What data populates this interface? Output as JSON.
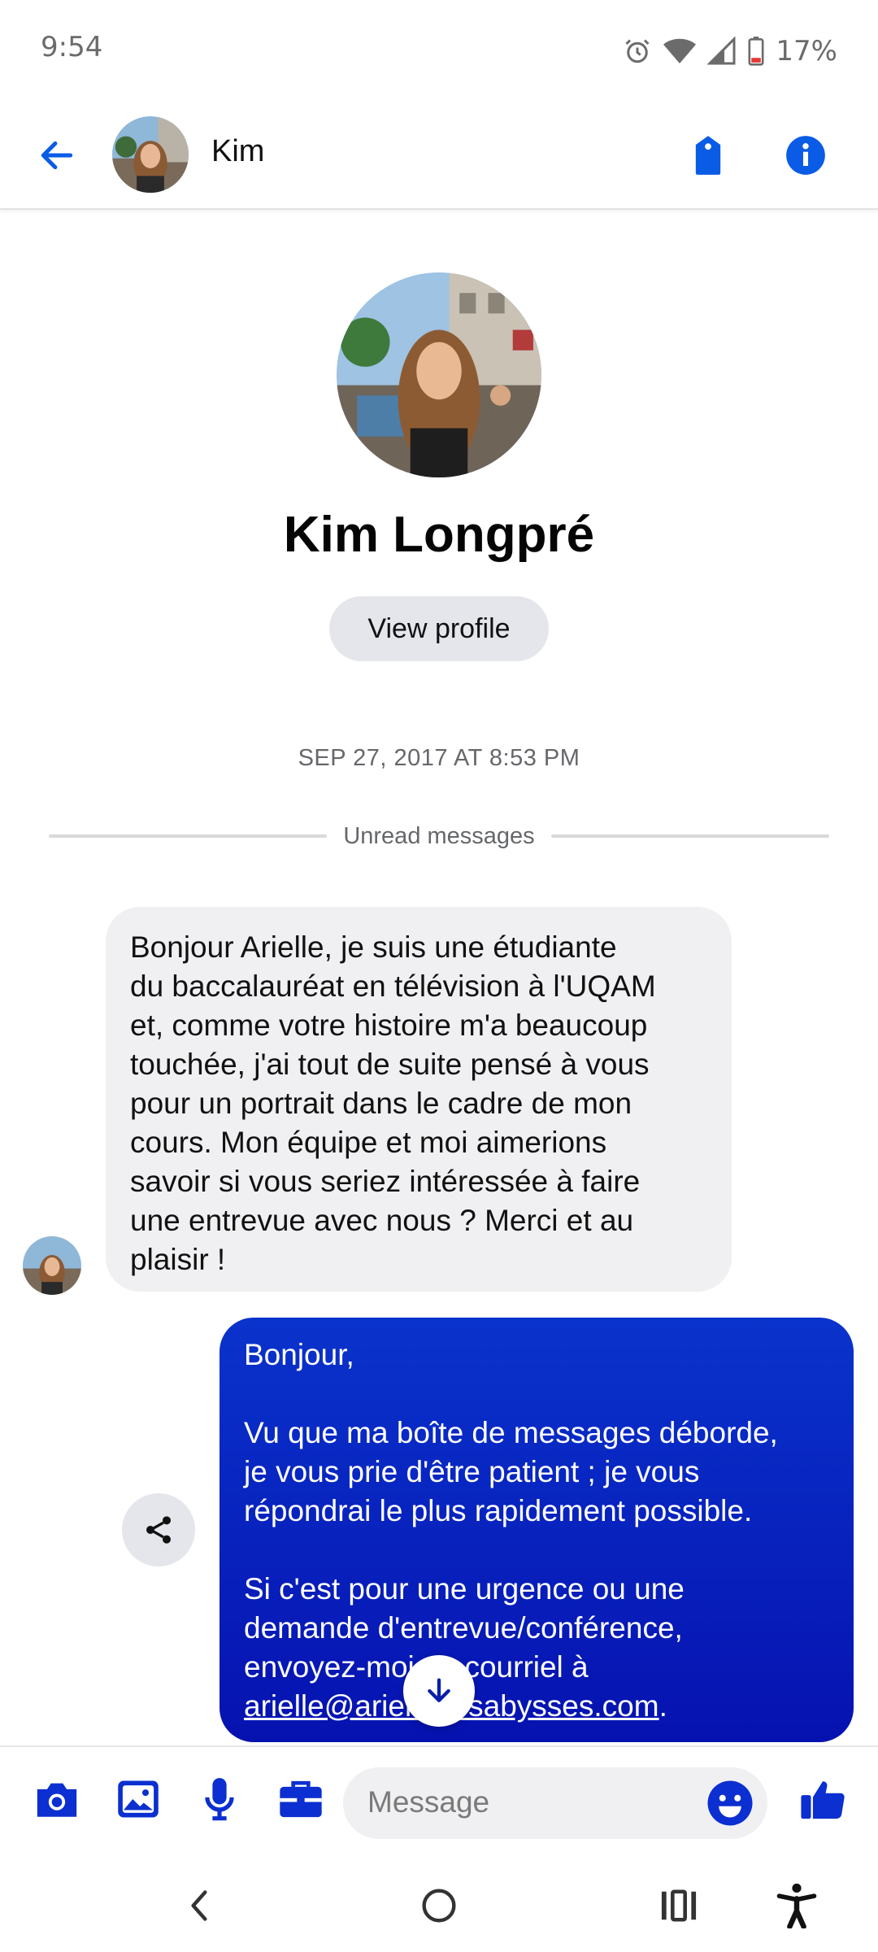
{
  "status_bar": {
    "time": "9:54",
    "battery": "17%",
    "icons": [
      "alarm-icon",
      "wifi-icon",
      "signal-icon",
      "battery-icon"
    ]
  },
  "header": {
    "contact_name": "Kim",
    "icons": [
      "back-arrow-icon",
      "tag-icon",
      "info-icon"
    ]
  },
  "profile": {
    "full_name": "Kim Longpré",
    "view_profile_label": "View profile"
  },
  "conversation": {
    "timestamp": "SEP 27, 2017 AT 8:53 PM",
    "unread_label": "Unread messages",
    "incoming_message": {
      "lines": [
        "Bonjour Arielle, je suis une étudiante",
        "du baccalauréat en télévision à l'UQAM",
        "et, comme votre histoire m'a beaucoup",
        "touchée, j'ai tout de suite pensé à vous",
        "pour un portrait dans le cadre de mon",
        "cours. Mon équipe et moi aimerions",
        "savoir si vous seriez intéressée à faire",
        "une entrevue avec nous ? Merci et au",
        "plaisir !"
      ]
    },
    "outgoing_message": {
      "lines": [
        "Bonjour,",
        "",
        "Vu que ma boîte de messages déborde,",
        "je vous prie d'être patient ; je vous",
        "répondrai le plus rapidement possible.",
        "",
        "Si c'est pour une urgence ou une",
        "demande d'entrevue/conférence,",
        "envoyez-moi un courriel à"
      ],
      "link": "arielle@arielledesabysses.com",
      "link_suffix": "."
    }
  },
  "composer": {
    "placeholder": "Message",
    "icons": [
      "camera-icon",
      "gallery-icon",
      "microphone-icon",
      "briefcase-icon",
      "emoji-icon",
      "thumbs-up-icon"
    ]
  },
  "nav_bar": {
    "icons": [
      "back-nav-icon",
      "home-nav-icon",
      "recents-nav-icon",
      "accessibility-icon"
    ]
  },
  "colors": {
    "accent": "#0a5ce6",
    "composer_icon": "#0b2fd0",
    "outgoing_bubble": "#0a33cc",
    "incoming_bubble": "#f0f0f2"
  }
}
